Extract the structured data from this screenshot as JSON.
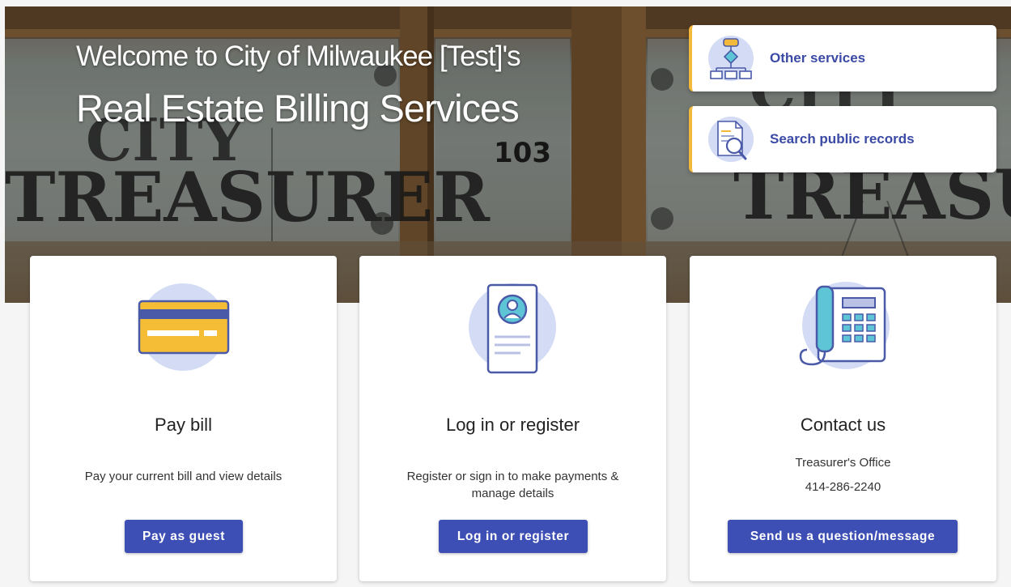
{
  "hero": {
    "title_line1": "Welcome to City of Milwaukee [Test]'s",
    "title_line2": "Real Estate Billing Services"
  },
  "quick_links": [
    {
      "label": "Other services",
      "icon": "flowchart-icon"
    },
    {
      "label": "Search public records",
      "icon": "document-search-icon"
    }
  ],
  "cards": {
    "pay": {
      "title": "Pay bill",
      "description": "Pay your current bill and view details",
      "button": "Pay as guest",
      "icon": "credit-card-icon"
    },
    "login": {
      "title": "Log in or register",
      "description": "Register or sign in to make payments & manage details",
      "button": "Log in or register",
      "icon": "user-profile-icon"
    },
    "contact": {
      "title": "Contact us",
      "office": "Treasurer's Office",
      "phone": "414-286-2240",
      "button": "Send us a question/message",
      "icon": "telephone-icon"
    }
  },
  "colors": {
    "accent": "#3d4fb5",
    "link_text": "#3a4aa5",
    "quick_link_border": "#f2b93b",
    "icon_circle": "#d4dcf5"
  }
}
